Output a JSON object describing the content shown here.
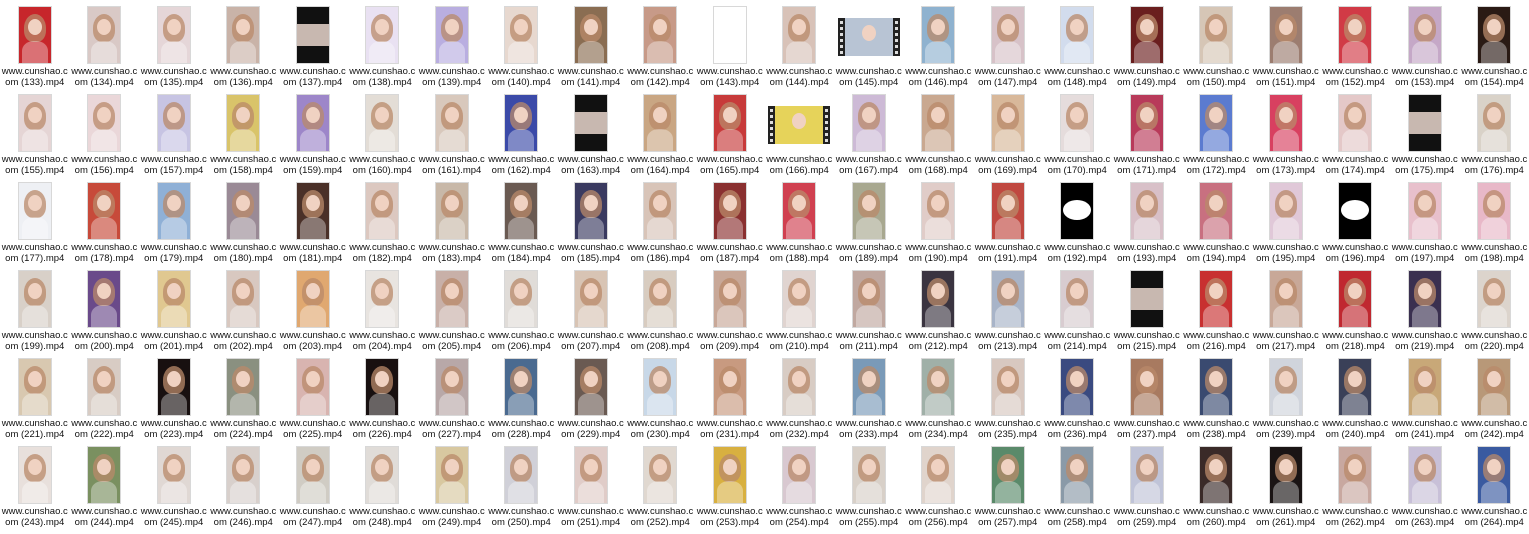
{
  "files": [
    {
      "name": "www.cunshao.com (133).mp4",
      "bg": "#c7262b",
      "kind": "portrait"
    },
    {
      "name": "www.cunshao.com (134).mp4",
      "bg": "#d9c9c6",
      "kind": "portrait"
    },
    {
      "name": "www.cunshao.com (135).mp4",
      "bg": "#e5d6d8",
      "kind": "portrait"
    },
    {
      "name": "www.cunshao.com (136).mp4",
      "bg": "#c9b3a8",
      "kind": "portrait"
    },
    {
      "name": "www.cunshao.com (137).mp4",
      "bg": "#111111",
      "kind": "dark"
    },
    {
      "name": "www.cunshao.com (138).mp4",
      "bg": "#e9e1f2",
      "kind": "portrait"
    },
    {
      "name": "www.cunshao.com (139).mp4",
      "bg": "#b9aee0",
      "kind": "portrait"
    },
    {
      "name": "www.cunshao.com (140).mp4",
      "bg": "#e7d8cf",
      "kind": "portrait"
    },
    {
      "name": "www.cunshao.com (141).mp4",
      "bg": "#8a6d52",
      "kind": "portrait"
    },
    {
      "name": "www.cunshao.com (142).mp4",
      "bg": "#c79a88",
      "kind": "portrait"
    },
    {
      "name": "www.cunshao.com (143).mp4",
      "bg": "#ffffff",
      "kind": "blank"
    },
    {
      "name": "www.cunshao.com (144).mp4",
      "bg": "#d8c2b8",
      "kind": "portrait"
    },
    {
      "name": "www.cunshao.com (145).mp4",
      "bg": "#b8c4d4",
      "kind": "video"
    },
    {
      "name": "www.cunshao.com (146).mp4",
      "bg": "#8fb2cf",
      "kind": "portrait"
    },
    {
      "name": "www.cunshao.com (147).mp4",
      "bg": "#d7c2c8",
      "kind": "portrait"
    },
    {
      "name": "www.cunshao.com (148).mp4",
      "bg": "#d2dced",
      "kind": "portrait"
    },
    {
      "name": "www.cunshao.com (149).mp4",
      "bg": "#6a1e1e",
      "kind": "portrait"
    },
    {
      "name": "www.cunshao.com (150).mp4",
      "bg": "#d6c6b6",
      "kind": "portrait"
    },
    {
      "name": "www.cunshao.com (151).mp4",
      "bg": "#9c7d70",
      "kind": "portrait"
    },
    {
      "name": "www.cunshao.com (152).mp4",
      "bg": "#d13a46",
      "kind": "portrait"
    },
    {
      "name": "www.cunshao.com (153).mp4",
      "bg": "#c5a8c7",
      "kind": "portrait"
    },
    {
      "name": "www.cunshao.com (154).mp4",
      "bg": "#2a1a14",
      "kind": "portrait"
    },
    {
      "name": "www.cunshao.com (155).mp4",
      "bg": "#e5d5d5",
      "kind": "portrait"
    },
    {
      "name": "www.cunshao.com (156).mp4",
      "bg": "#ead7d9",
      "kind": "portrait"
    },
    {
      "name": "www.cunshao.com (157).mp4",
      "bg": "#c7c4e3",
      "kind": "portrait"
    },
    {
      "name": "www.cunshao.com (158).mp4",
      "bg": "#d9c46a",
      "kind": "portrait"
    },
    {
      "name": "www.cunshao.com (159).mp4",
      "bg": "#9d86c9",
      "kind": "portrait"
    },
    {
      "name": "www.cunshao.com (160).mp4",
      "bg": "#e3ddd6",
      "kind": "portrait"
    },
    {
      "name": "www.cunshao.com (161).mp4",
      "bg": "#d8c8bc",
      "kind": "portrait"
    },
    {
      "name": "www.cunshao.com (162).mp4",
      "bg": "#3b4aa8",
      "kind": "portrait"
    },
    {
      "name": "www.cunshao.com (163).mp4",
      "bg": "#111111",
      "kind": "dark"
    },
    {
      "name": "www.cunshao.com (164).mp4",
      "bg": "#c9a683",
      "kind": "portrait"
    },
    {
      "name": "www.cunshao.com (165).mp4",
      "bg": "#c73a3a",
      "kind": "portrait"
    },
    {
      "name": "www.cunshao.com (166).mp4",
      "bg": "#e6d35a",
      "kind": "video"
    },
    {
      "name": "www.cunshao.com (167).mp4",
      "bg": "#cdbad6",
      "kind": "portrait"
    },
    {
      "name": "www.cunshao.com (168).mp4",
      "bg": "#c9a890",
      "kind": "portrait"
    },
    {
      "name": "www.cunshao.com (169).mp4",
      "bg": "#d8b89a",
      "kind": "portrait"
    },
    {
      "name": "www.cunshao.com (170).mp4",
      "bg": "#e5dcdc",
      "kind": "portrait"
    },
    {
      "name": "www.cunshao.com (171).mp4",
      "bg": "#b83a5a",
      "kind": "portrait"
    },
    {
      "name": "www.cunshao.com (172).mp4",
      "bg": "#5b7bd0",
      "kind": "portrait"
    },
    {
      "name": "www.cunshao.com (173).mp4",
      "bg": "#d84060",
      "kind": "portrait"
    },
    {
      "name": "www.cunshao.com (174).mp4",
      "bg": "#e4c8c8",
      "kind": "portrait"
    },
    {
      "name": "www.cunshao.com (175).mp4",
      "bg": "#111111",
      "kind": "dark"
    },
    {
      "name": "www.cunshao.com (176).mp4",
      "bg": "#d9d2c8",
      "kind": "portrait"
    },
    {
      "name": "www.cunshao.com (177).mp4",
      "bg": "#eef0f4",
      "kind": "portrait"
    },
    {
      "name": "www.cunshao.com (178).mp4",
      "bg": "#c74a3a",
      "kind": "portrait"
    },
    {
      "name": "www.cunshao.com (179).mp4",
      "bg": "#8fb0d6",
      "kind": "portrait"
    },
    {
      "name": "www.cunshao.com (180).mp4",
      "bg": "#9a8a96",
      "kind": "portrait"
    },
    {
      "name": "www.cunshao.com (181).mp4",
      "bg": "#4a3028",
      "kind": "portrait"
    },
    {
      "name": "www.cunshao.com (182).mp4",
      "bg": "#dcc8c0",
      "kind": "portrait"
    },
    {
      "name": "www.cunshao.com (183).mp4",
      "bg": "#c8b8a8",
      "kind": "portrait"
    },
    {
      "name": "www.cunshao.com (184).mp4",
      "bg": "#6a5a52",
      "kind": "portrait"
    },
    {
      "name": "www.cunshao.com (185).mp4",
      "bg": "#3a3a60",
      "kind": "portrait"
    },
    {
      "name": "www.cunshao.com (186).mp4",
      "bg": "#d8c4b8",
      "kind": "portrait"
    },
    {
      "name": "www.cunshao.com (187).mp4",
      "bg": "#8a3030",
      "kind": "portrait"
    },
    {
      "name": "www.cunshao.com (188).mp4",
      "bg": "#d04050",
      "kind": "portrait"
    },
    {
      "name": "www.cunshao.com (189).mp4",
      "bg": "#a8a890",
      "kind": "portrait"
    },
    {
      "name": "www.cunshao.com (190).mp4",
      "bg": "#e0ccc8",
      "kind": "portrait"
    },
    {
      "name": "www.cunshao.com (191).mp4",
      "bg": "#c04840",
      "kind": "portrait"
    },
    {
      "name": "www.cunshao.com (192).mp4",
      "bg": "#000000",
      "kind": "oval"
    },
    {
      "name": "www.cunshao.com (193).mp4",
      "bg": "#d8c0c8",
      "kind": "portrait"
    },
    {
      "name": "www.cunshao.com (194).mp4",
      "bg": "#c87080",
      "kind": "portrait"
    },
    {
      "name": "www.cunshao.com (195).mp4",
      "bg": "#e0c8d8",
      "kind": "portrait"
    },
    {
      "name": "www.cunshao.com (196).mp4",
      "bg": "#000000",
      "kind": "oval"
    },
    {
      "name": "www.cunshao.com (197).mp4",
      "bg": "#e8c0cc",
      "kind": "portrait"
    },
    {
      "name": "www.cunshao.com (198).mp4",
      "bg": "#e8b8c8",
      "kind": "portrait"
    },
    {
      "name": "www.cunshao.com (199).mp4",
      "bg": "#d8d0c8",
      "kind": "portrait"
    },
    {
      "name": "www.cunshao.com (200).mp4",
      "bg": "#6a4a8a",
      "kind": "portrait"
    },
    {
      "name": "www.cunshao.com (201).mp4",
      "bg": "#e0c890",
      "kind": "portrait"
    },
    {
      "name": "www.cunshao.com (202).mp4",
      "bg": "#d8c8c0",
      "kind": "portrait"
    },
    {
      "name": "www.cunshao.com (203).mp4",
      "bg": "#e0a870",
      "kind": "portrait"
    },
    {
      "name": "www.cunshao.com (204).mp4",
      "bg": "#e8e4e0",
      "kind": "portrait"
    },
    {
      "name": "www.cunshao.com (205).mp4",
      "bg": "#c8b0a8",
      "kind": "portrait"
    },
    {
      "name": "www.cunshao.com (206).mp4",
      "bg": "#e0dcd8",
      "kind": "portrait"
    },
    {
      "name": "www.cunshao.com (207).mp4",
      "bg": "#d8c4b4",
      "kind": "portrait"
    },
    {
      "name": "www.cunshao.com (208).mp4",
      "bg": "#d8ccc0",
      "kind": "portrait"
    },
    {
      "name": "www.cunshao.com (209).mp4",
      "bg": "#c8a898",
      "kind": "portrait"
    },
    {
      "name": "www.cunshao.com (210).mp4",
      "bg": "#e0d4d0",
      "kind": "portrait"
    },
    {
      "name": "www.cunshao.com (211).mp4",
      "bg": "#c0a8a0",
      "kind": "portrait"
    },
    {
      "name": "www.cunshao.com (212).mp4",
      "bg": "#3a3440",
      "kind": "portrait"
    },
    {
      "name": "www.cunshao.com (213).mp4",
      "bg": "#a8b4c8",
      "kind": "portrait"
    },
    {
      "name": "www.cunshao.com (214).mp4",
      "bg": "#d8ccd0",
      "kind": "portrait"
    },
    {
      "name": "www.cunshao.com (215).mp4",
      "bg": "#111111",
      "kind": "dark"
    },
    {
      "name": "www.cunshao.com (216).mp4",
      "bg": "#c83030",
      "kind": "portrait"
    },
    {
      "name": "www.cunshao.com (217).mp4",
      "bg": "#c8a898",
      "kind": "portrait"
    },
    {
      "name": "www.cunshao.com (218).mp4",
      "bg": "#c02830",
      "kind": "portrait"
    },
    {
      "name": "www.cunshao.com (219).mp4",
      "bg": "#3a3050",
      "kind": "portrait"
    },
    {
      "name": "www.cunshao.com (220).mp4",
      "bg": "#dcd4cc",
      "kind": "portrait"
    },
    {
      "name": "www.cunshao.com (221).mp4",
      "bg": "#d8c8b0",
      "kind": "portrait"
    },
    {
      "name": "www.cunshao.com (222).mp4",
      "bg": "#d8ccc4",
      "kind": "portrait"
    },
    {
      "name": "www.cunshao.com (223).mp4",
      "bg": "#181010",
      "kind": "portrait"
    },
    {
      "name": "www.cunshao.com (224).mp4",
      "bg": "#8a9080",
      "kind": "portrait"
    },
    {
      "name": "www.cunshao.com (225).mp4",
      "bg": "#d8b4b0",
      "kind": "portrait"
    },
    {
      "name": "www.cunshao.com (226).mp4",
      "bg": "#181010",
      "kind": "portrait"
    },
    {
      "name": "www.cunshao.com (227).mp4",
      "bg": "#b8a8a8",
      "kind": "portrait"
    },
    {
      "name": "www.cunshao.com (228).mp4",
      "bg": "#4a6a90",
      "kind": "portrait"
    },
    {
      "name": "www.cunshao.com (229).mp4",
      "bg": "#6a5a52",
      "kind": "portrait"
    },
    {
      "name": "www.cunshao.com (230).mp4",
      "bg": "#c8d8e8",
      "kind": "portrait"
    },
    {
      "name": "www.cunshao.com (231).mp4",
      "bg": "#c89a80",
      "kind": "portrait"
    },
    {
      "name": "www.cunshao.com (232).mp4",
      "bg": "#d8ccc4",
      "kind": "portrait"
    },
    {
      "name": "www.cunshao.com (233).mp4",
      "bg": "#7a9ab8",
      "kind": "portrait"
    },
    {
      "name": "www.cunshao.com (234).mp4",
      "bg": "#a0b0a8",
      "kind": "portrait"
    },
    {
      "name": "www.cunshao.com (235).mp4",
      "bg": "#d8c8c0",
      "kind": "portrait"
    },
    {
      "name": "www.cunshao.com (236).mp4",
      "bg": "#3a4a80",
      "kind": "portrait"
    },
    {
      "name": "www.cunshao.com (237).mp4",
      "bg": "#a87a60",
      "kind": "portrait"
    },
    {
      "name": "www.cunshao.com (238).mp4",
      "bg": "#3a4a70",
      "kind": "portrait"
    },
    {
      "name": "www.cunshao.com (239).mp4",
      "bg": "#d0d4dc",
      "kind": "portrait"
    },
    {
      "name": "www.cunshao.com (240).mp4",
      "bg": "#3a4058",
      "kind": "portrait"
    },
    {
      "name": "www.cunshao.com (241).mp4",
      "bg": "#c8a878",
      "kind": "portrait"
    },
    {
      "name": "www.cunshao.com (242).mp4",
      "bg": "#b89878",
      "kind": "portrait"
    },
    {
      "name": "www.cunshao.com (243).mp4",
      "bg": "#e8e0dc",
      "kind": "portrait"
    },
    {
      "name": "www.cunshao.com (244).mp4",
      "bg": "#7a9060",
      "kind": "portrait"
    },
    {
      "name": "www.cunshao.com (245).mp4",
      "bg": "#e0d8d4",
      "kind": "portrait"
    },
    {
      "name": "www.cunshao.com (246).mp4",
      "bg": "#d8d0cc",
      "kind": "portrait"
    },
    {
      "name": "www.cunshao.com (247).mp4",
      "bg": "#d0ccc4",
      "kind": "portrait"
    },
    {
      "name": "www.cunshao.com (248).mp4",
      "bg": "#e0dcd8",
      "kind": "portrait"
    },
    {
      "name": "www.cunshao.com (249).mp4",
      "bg": "#d8c8a0",
      "kind": "portrait"
    },
    {
      "name": "www.cunshao.com (250).mp4",
      "bg": "#d0d0d8",
      "kind": "portrait"
    },
    {
      "name": "www.cunshao.com (251).mp4",
      "bg": "#e0ccc8",
      "kind": "portrait"
    },
    {
      "name": "www.cunshao.com (252).mp4",
      "bg": "#e0d8d0",
      "kind": "portrait"
    },
    {
      "name": "www.cunshao.com (253).mp4",
      "bg": "#d8b040",
      "kind": "portrait"
    },
    {
      "name": "www.cunshao.com (254).mp4",
      "bg": "#d8c8d0",
      "kind": "portrait"
    },
    {
      "name": "www.cunshao.com (255).mp4",
      "bg": "#d8d0c8",
      "kind": "portrait"
    },
    {
      "name": "www.cunshao.com (256).mp4",
      "bg": "#e0d4cc",
      "kind": "portrait"
    },
    {
      "name": "www.cunshao.com (257).mp4",
      "bg": "#5a8a6a",
      "kind": "portrait"
    },
    {
      "name": "www.cunshao.com (258).mp4",
      "bg": "#8a9aa8",
      "kind": "portrait"
    },
    {
      "name": "www.cunshao.com (259).mp4",
      "bg": "#c0c4d8",
      "kind": "portrait"
    },
    {
      "name": "www.cunshao.com (260).mp4",
      "bg": "#3a2a28",
      "kind": "portrait"
    },
    {
      "name": "www.cunshao.com (261).mp4",
      "bg": "#1a1414",
      "kind": "portrait"
    },
    {
      "name": "www.cunshao.com (262).mp4",
      "bg": "#c8a8a0",
      "kind": "portrait"
    },
    {
      "name": "www.cunshao.com (263).mp4",
      "bg": "#c8c0d8",
      "kind": "portrait"
    },
    {
      "name": "www.cunshao.com (264).mp4",
      "bg": "#3a5aa0",
      "kind": "portrait"
    }
  ]
}
